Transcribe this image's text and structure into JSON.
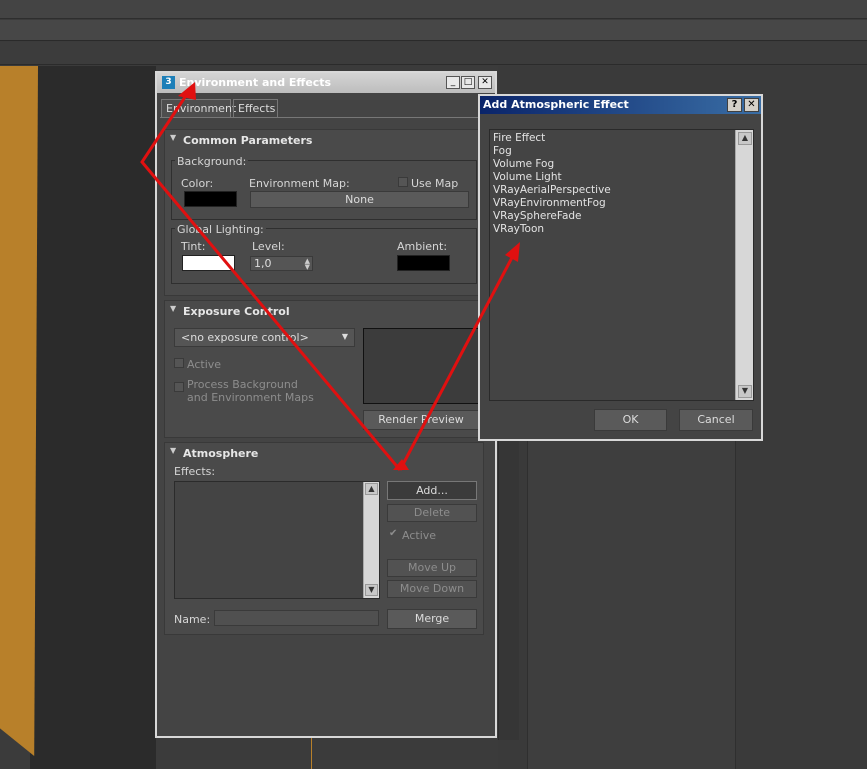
{
  "main_window": {
    "title": "Environment and Effects",
    "title_icon": "3",
    "controls": {
      "minimize": "_",
      "maximize": "□",
      "close": "✕"
    },
    "tabs": [
      {
        "label": "Environment",
        "active": true
      },
      {
        "label": "Effects",
        "active": false
      }
    ],
    "common_parameters": {
      "header": "Common Parameters",
      "background_group": "Background:",
      "color_label": "Color:",
      "color_value": "#000000",
      "env_map_label": "Environment Map:",
      "use_map_label": "Use Map",
      "env_map_button": "None",
      "global_lighting_group": "Global Lighting:",
      "tint_label": "Tint:",
      "tint_value": "#ffffff",
      "level_label": "Level:",
      "level_value": "1,0",
      "ambient_label": "Ambient:",
      "ambient_value": "#000000"
    },
    "exposure_control": {
      "header": "Exposure Control",
      "dropdown_value": "<no exposure control>",
      "active_label": "Active",
      "process_bg_label_1": "Process Background",
      "process_bg_label_2": "and Environment Maps",
      "render_preview_button": "Render Preview"
    },
    "atmosphere": {
      "header": "Atmosphere",
      "effects_label": "Effects:",
      "add_button": "Add...",
      "delete_button": "Delete",
      "active_label": "Active",
      "move_up_button": "Move Up",
      "move_down_button": "Move Down",
      "name_label": "Name:",
      "name_value": "",
      "merge_button": "Merge"
    }
  },
  "dialog": {
    "title": "Add Atmospheric Effect",
    "help_button": "?",
    "close_button": "✕",
    "items": [
      "Fire Effect",
      "Fog",
      "Volume Fog",
      "Volume Light",
      "VRayAerialPerspective",
      "VRayEnvironmentFog",
      "VRaySphereFade",
      "VRayToon"
    ],
    "ok_button": "OK",
    "cancel_button": "Cancel"
  },
  "colors": {
    "annotation_arrow": "#e01010",
    "orange_object": "#b8802a",
    "dialog_title": "#0a246a"
  }
}
